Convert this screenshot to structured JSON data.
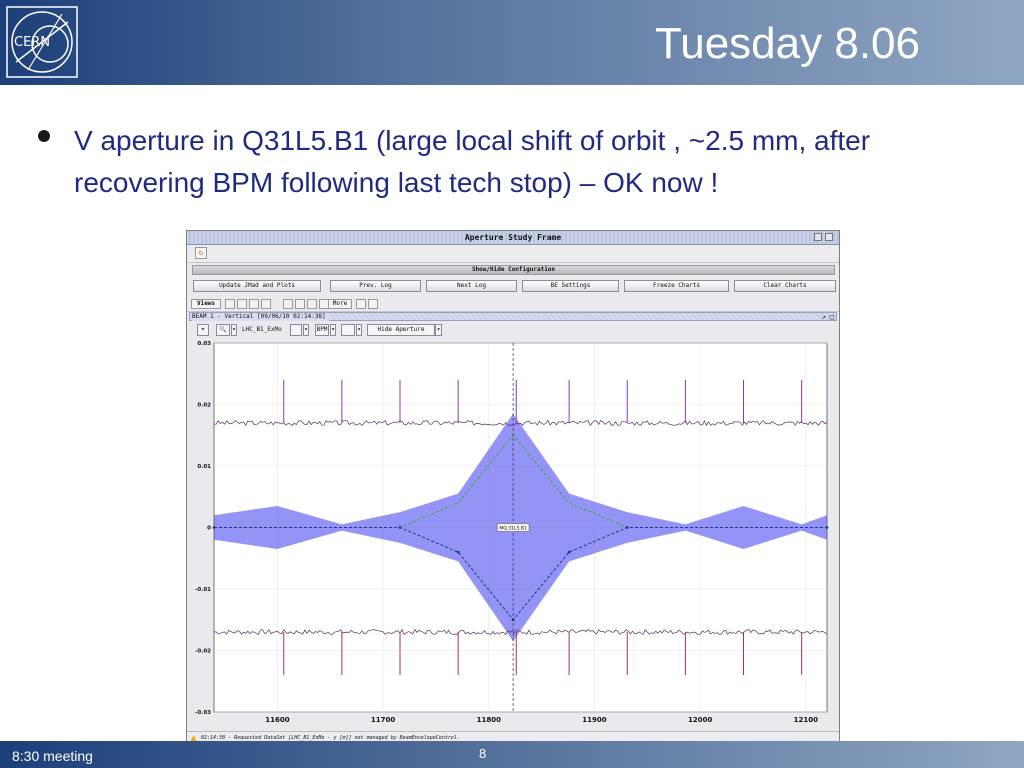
{
  "slide": {
    "title": "Tuesday 8.06",
    "bullet": "V aperture in Q31L5.B1 (large local shift of orbit , ~2.5 mm, after recovering BPM following last tech stop) – OK now !",
    "logo_text": "CERN",
    "footer_left": "8:30 meeting",
    "page_number": "8"
  },
  "app": {
    "window_title": "Aperture Study Frame",
    "config_toggle": "Show/Hide Configuration",
    "buttons": [
      "Update JMad and Plots",
      "Prev. Log",
      "Next Log",
      "BE Settings",
      "Freeze Charts",
      "Clear Charts"
    ],
    "views_label": "Views",
    "more_label": "More",
    "plot_title": "BEAM 1 - Vertical  [09/06/10 02:14:38]",
    "dataset_select": "LHC_B1_ExMo",
    "bpm_label": "BPM",
    "hide_aperture": "Hide Aperture",
    "status_text": "02:14:30 - Requested DataSet [LHC_B1_ExMo - y [m]] not managed by BeamEnvelopeControl.",
    "colors": {
      "envelope": "#3d3df0",
      "trace": "#5a2a6a",
      "orbit": "#3aa63a"
    }
  },
  "chart_data": {
    "type": "line",
    "xlim": [
      11540,
      12120
    ],
    "ylim": [
      -0.03,
      0.03
    ],
    "x_ticks": [
      11600,
      11700,
      11800,
      11900,
      12000,
      12100
    ],
    "y_ticks": [
      -0.03,
      -0.02,
      -0.01,
      0,
      0.01,
      0.02,
      0.03
    ],
    "x_tick_labels": [
      "11600",
      "11700",
      "11800",
      "11900",
      "12000",
      "12100"
    ],
    "y_tick_labels": [
      "-0.03",
      "-0.02",
      "-0.01",
      "0",
      "0.01",
      "0.02",
      "0.03"
    ],
    "marker_x": 11823,
    "marker_label": "MQ.31L5.B1",
    "aperture_upper": 0.017,
    "aperture_lower": -0.017,
    "spike_x": [
      11606,
      11661,
      11716,
      11771,
      11826,
      11876,
      11931,
      11986,
      12041,
      12096
    ],
    "spike_upper": 0.024,
    "spike_lower": -0.024,
    "envelope": {
      "x": [
        11540,
        11600,
        11661,
        11716,
        11771,
        11823,
        11876,
        11931,
        11986,
        12041,
        12096,
        12120
      ],
      "upper": [
        0.002,
        0.0035,
        0.0005,
        0.0025,
        0.0055,
        0.0185,
        0.0055,
        0.0025,
        0.0005,
        0.0035,
        0.0005,
        0.002
      ],
      "lower": [
        -0.002,
        -0.0035,
        -0.0005,
        -0.0025,
        -0.0055,
        -0.0185,
        -0.0055,
        -0.0025,
        -0.0005,
        -0.0035,
        -0.0005,
        -0.002
      ]
    },
    "orbit": {
      "x": [
        11540,
        11716,
        11771,
        11823,
        11876,
        11931,
        12120
      ],
      "upper": [
        0,
        0,
        0.004,
        0.015,
        0.004,
        0,
        0
      ],
      "lower": [
        0,
        0,
        -0.004,
        -0.015,
        -0.004,
        0,
        0
      ]
    }
  }
}
